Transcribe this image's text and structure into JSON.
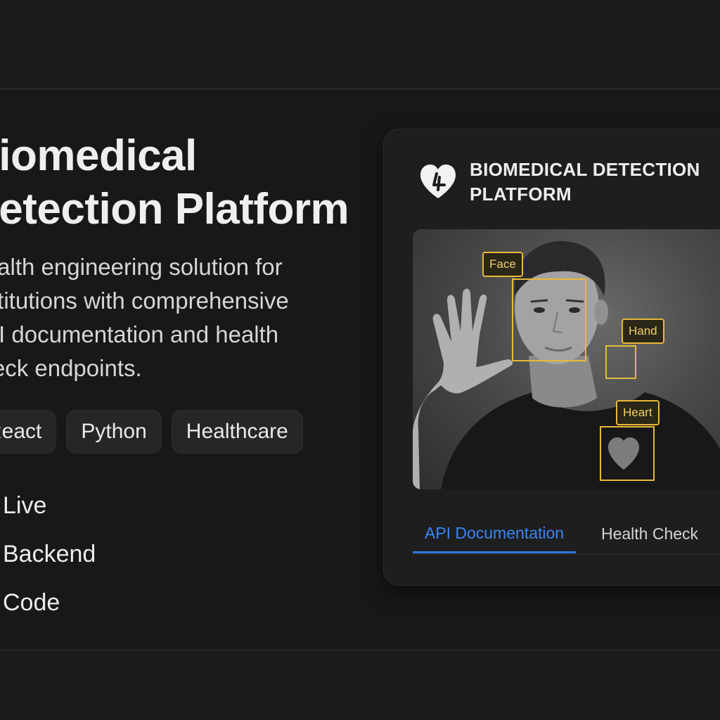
{
  "hero": {
    "title": "Biomedical\nDetection Platform",
    "description": "Health engineering solution for\ninstitutions with comprehensive\nAPI documentation and health\ncheck endpoints."
  },
  "tags": [
    {
      "label": "React"
    },
    {
      "label": "Python"
    },
    {
      "label": "Healthcare"
    }
  ],
  "links": [
    {
      "label": "Live"
    },
    {
      "label": "Backend"
    },
    {
      "label": "Code"
    }
  ],
  "card": {
    "title": "BIOMEDICAL DETECTION\nPLATFORM",
    "logo_icon": "heart-plus-icon",
    "detections": [
      {
        "label": "Face"
      },
      {
        "label": "Hand"
      },
      {
        "label": "Heart"
      }
    ],
    "tabs": [
      {
        "label": "API Documentation",
        "active": true
      },
      {
        "label": "Health Check",
        "active": false
      }
    ]
  },
  "colors": {
    "background": "#1a1a1b",
    "accent": "#2f78e8",
    "detection": "#e7b93b"
  }
}
